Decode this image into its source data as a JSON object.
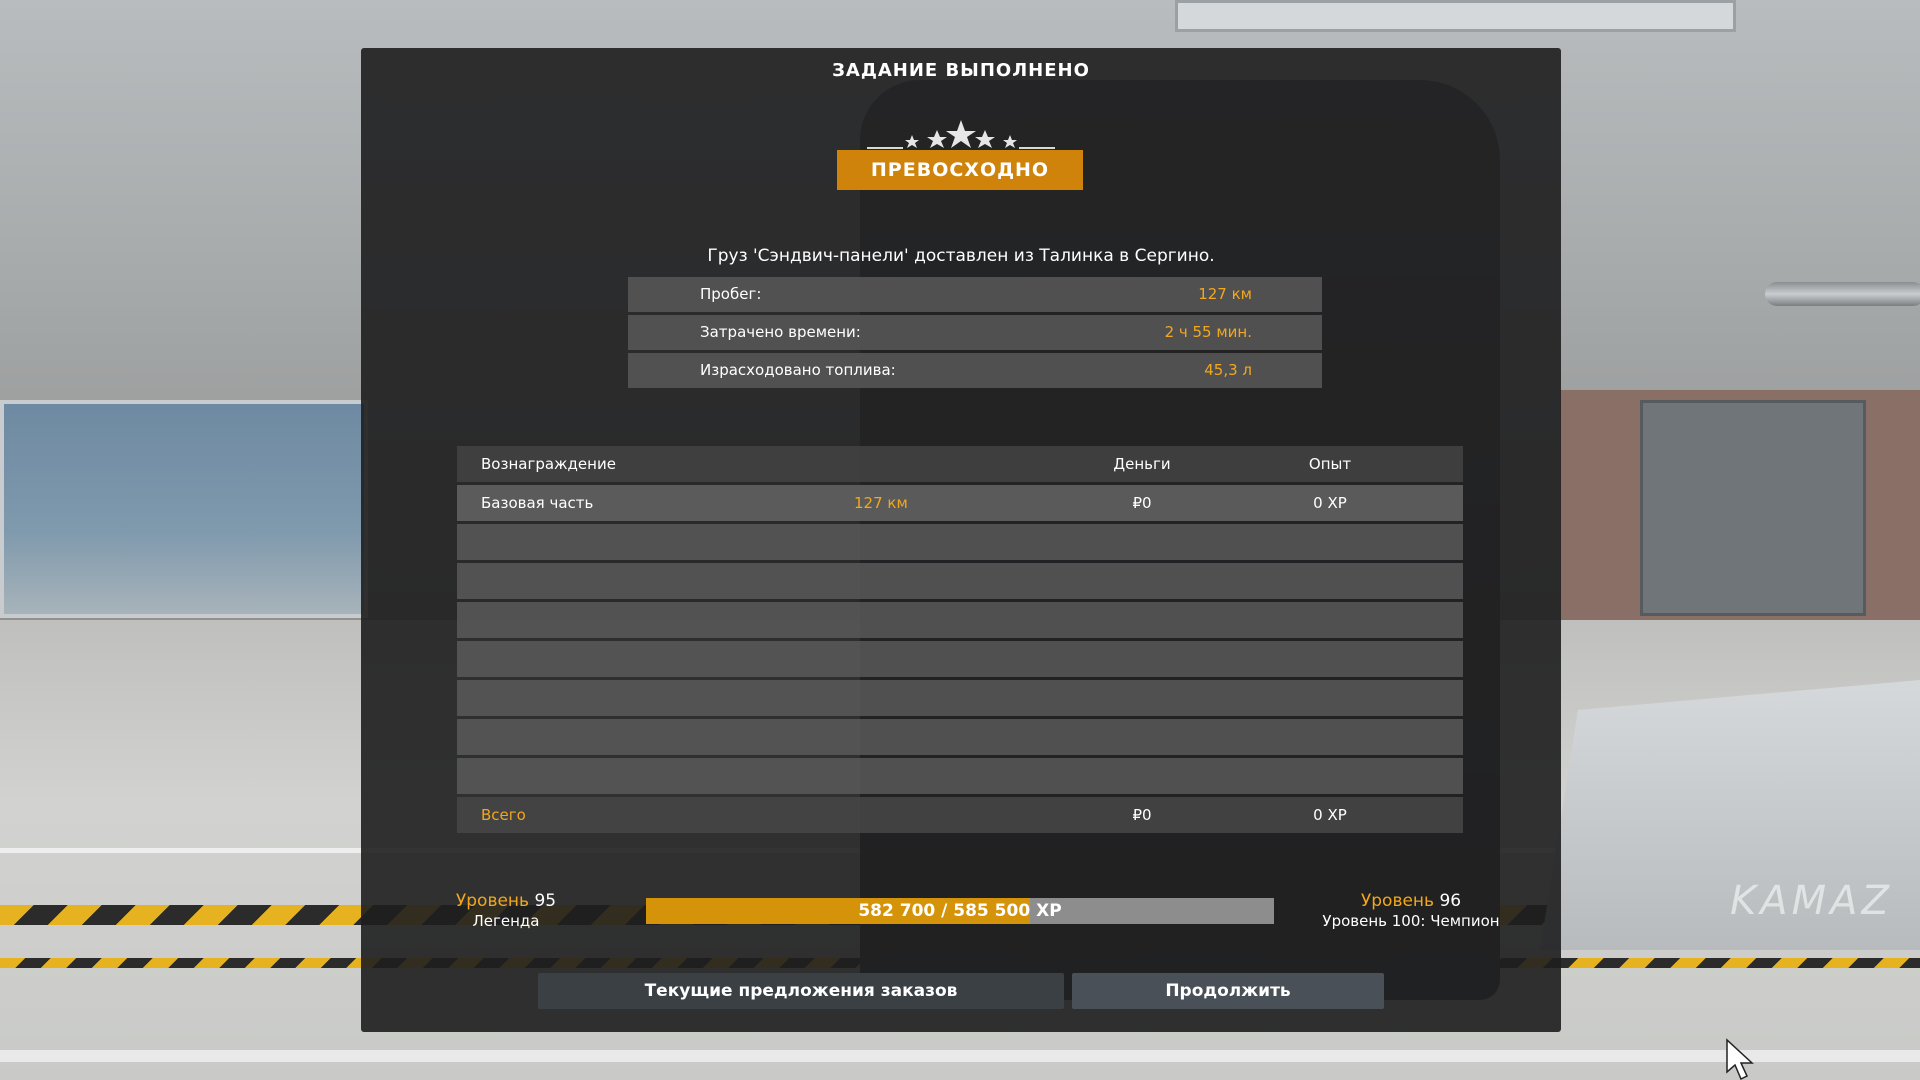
{
  "dialog": {
    "title": "ЗАДАНИЕ ВЫПОЛНЕНО",
    "rating_stars": 5,
    "rating_label": "ПРЕВОСХОДНО",
    "cargo_text": "Груз 'Сэндвич-панели' доставлен из Талинка в Сергино."
  },
  "stats": [
    {
      "label": "Пробег:",
      "value": "127 км"
    },
    {
      "label": "Затрачено времени:",
      "value": "2 ч 55 мин."
    },
    {
      "label": "Израсходовано топлива:",
      "value": "45,3 л"
    }
  ],
  "rewards": {
    "header": {
      "name": "Вознаграждение",
      "money": "Деньги",
      "xp": "Опыт"
    },
    "rows": [
      {
        "name": "Базовая часть",
        "detail": "127 км",
        "money": "₽0",
        "xp": "0 XP"
      }
    ],
    "total": {
      "name": "Всего",
      "money": "₽0",
      "xp": "0 XP"
    }
  },
  "progress": {
    "current_level_word": "Уровень",
    "current_level_num": "95",
    "current_title": "Легенда",
    "next_level_word": "Уровень",
    "next_level_num": "96",
    "next_title": "Уровень 100: Чемпион",
    "xp_text": "582 700 / 585 500 XP",
    "xp_fraction": 0.612
  },
  "buttons": {
    "offers": "Текущие предложения заказов",
    "continue": "Продолжить"
  },
  "colors": {
    "accent": "#f2a71c",
    "badge": "#d0830b",
    "xp_fill": "#d49309"
  },
  "background": {
    "truck_logo": "KAMAZ"
  }
}
